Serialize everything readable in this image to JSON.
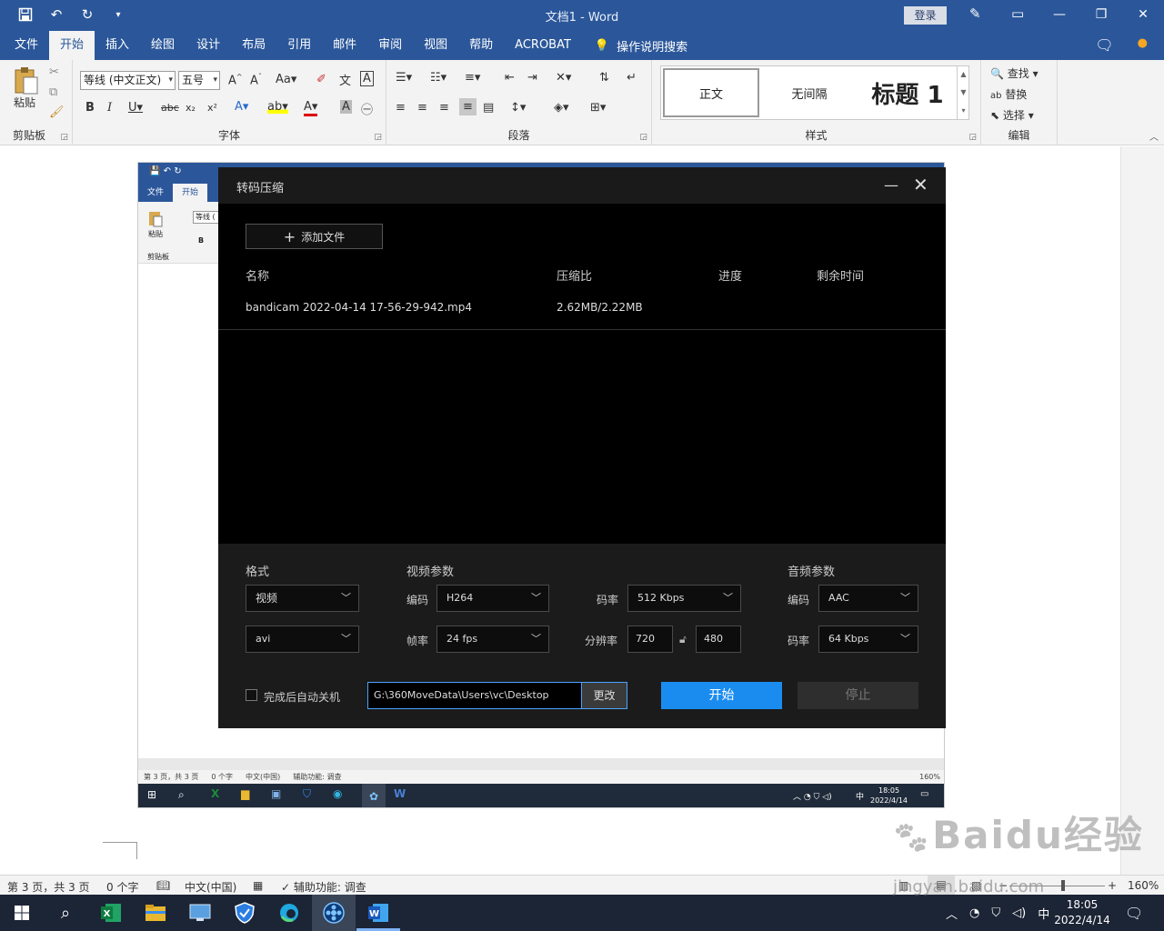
{
  "window": {
    "doc_title": "文档1  -  Word",
    "login_label": "登录"
  },
  "tabs": [
    {
      "label": "文件"
    },
    {
      "label": "开始"
    },
    {
      "label": "插入"
    },
    {
      "label": "绘图"
    },
    {
      "label": "设计"
    },
    {
      "label": "布局"
    },
    {
      "label": "引用"
    },
    {
      "label": "邮件"
    },
    {
      "label": "审阅"
    },
    {
      "label": "视图"
    },
    {
      "label": "帮助"
    },
    {
      "label": "ACROBAT"
    }
  ],
  "tell_me": "操作说明搜索",
  "ribbon": {
    "clipboard": {
      "paste_label": "粘贴",
      "group_label": "剪贴板"
    },
    "font": {
      "font_name": "等线 (中文正文)",
      "font_size": "五号",
      "group_label": "字体"
    },
    "paragraph": {
      "group_label": "段落"
    },
    "styles": {
      "normal": "正文",
      "no_spacing": "无间隔",
      "heading1": "标题 1",
      "group_label": "样式"
    },
    "editing": {
      "find": "查找",
      "replace": "替换",
      "select": "选择",
      "group_label": "编辑"
    }
  },
  "embed": {
    "tabs": [
      "文件",
      "开始"
    ],
    "paste_label": "粘贴",
    "font_name": "等线 (",
    "group_label": "剪贴板",
    "status": {
      "page": "第 3 页，共 3 页",
      "words": "0 个字",
      "lang": "中文(中国)",
      "access": "辅助功能: 调查",
      "zoom": "160%"
    },
    "clock_time": "18:05",
    "clock_date": "2022/4/14",
    "ime": "中"
  },
  "dialog": {
    "title": "转码压缩",
    "add_file": "添加文件",
    "columns": {
      "name": "名称",
      "ratio": "压缩比",
      "progress": "进度",
      "remaining": "剩余时间"
    },
    "files": [
      {
        "name": "bandicam 2022-04-14 17-56-29-942.mp4",
        "ratio": "2.62MB/2.22MB",
        "progress": "",
        "remaining": ""
      }
    ],
    "format": {
      "section": "格式",
      "type": "视频",
      "container": "avi"
    },
    "video": {
      "section": "视频参数",
      "codec_label": "编码",
      "codec": "H264",
      "fps_label": "帧率",
      "fps": "24 fps",
      "bitrate_label": "码率",
      "bitrate": "512 Kbps",
      "resolution_label": "分辨率",
      "width": "720",
      "height": "480"
    },
    "audio": {
      "section": "音频参数",
      "codec_label": "编码",
      "codec": "AAC",
      "bitrate_label": "码率",
      "bitrate": "64 Kbps"
    },
    "auto_shutdown": "完成后自动关机",
    "output_path": "G:\\360MoveData\\Users\\vc\\Desktop",
    "change": "更改",
    "start": "开始",
    "stop": "停止"
  },
  "status": {
    "page": "第 3 页，共 3 页",
    "words": "0 个字",
    "lang": "中文(中国)",
    "access": "辅助功能: 调查",
    "zoom": "160%"
  },
  "taskbar": {
    "ime": "中",
    "time": "18:05",
    "date": "2022/4/14"
  },
  "watermark": {
    "logo": "Baidu经验",
    "url": "jingyan.baidu.com"
  },
  "colors": {
    "word_blue": "#2b579a",
    "start_blue": "#1a8cf0",
    "dialog_bg": "#000000",
    "taskbar": "#1c2536"
  }
}
